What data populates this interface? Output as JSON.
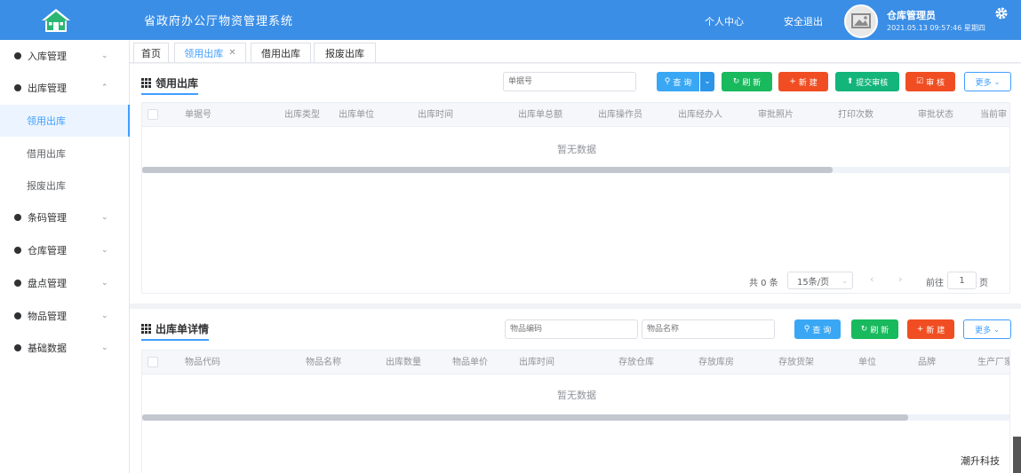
{
  "app": {
    "title": "省政府办公厅物资管理系统",
    "personal_center": "个人中心",
    "logout": "安全退出",
    "user_role": "仓库管理员",
    "user_time": "2021.05.13 09:57:46 星期四"
  },
  "sidebar": {
    "items": [
      {
        "label": "入库管理",
        "arrow": "⌄"
      },
      {
        "label": "出库管理",
        "arrow": "⌃"
      },
      {
        "label": "条码管理",
        "arrow": "⌄"
      },
      {
        "label": "仓库管理",
        "arrow": "⌄"
      },
      {
        "label": "盘点管理",
        "arrow": "⌄"
      },
      {
        "label": "物品管理",
        "arrow": "⌄"
      },
      {
        "label": "基础数据",
        "arrow": "⌄"
      }
    ],
    "submenu": [
      {
        "label": "领用出库"
      },
      {
        "label": "借用出库"
      },
      {
        "label": "报废出库"
      }
    ]
  },
  "tabs": [
    {
      "label": "首页"
    },
    {
      "label": "领用出库",
      "close": "✕"
    },
    {
      "label": "借用出库"
    },
    {
      "label": "报废出库"
    }
  ],
  "panel1": {
    "title": "领用出库",
    "search_placeholder": "单据号",
    "buttons": {
      "query": "查 询",
      "refresh": "刷 新",
      "new": "新 建",
      "submit": "提交审核",
      "review": "审 核",
      "more": "更多"
    },
    "columns": [
      "单据号",
      "出库类型",
      "出库单位",
      "出库时间",
      "出库单总额",
      "出库操作员",
      "出库经办人",
      "审批照片",
      "打印次数",
      "审批状态",
      "当前审"
    ],
    "empty_text": "暂无数据",
    "pager": {
      "total": "共 0 条",
      "page_size": "15条/页",
      "goto": "前往",
      "page": "1",
      "page_unit": "页"
    }
  },
  "panel2": {
    "title": "出库单详情",
    "code_placeholder": "物品编码",
    "name_placeholder": "物品名称",
    "buttons": {
      "query": "查 询",
      "refresh": "刷 新",
      "new": "新 建",
      "more": "更多"
    },
    "columns": [
      "物品代码",
      "物品名称",
      "出库数量",
      "物品单价",
      "出库时间",
      "存放仓库",
      "存放库房",
      "存放货架",
      "单位",
      "品牌",
      "生产厂家"
    ],
    "empty_text": "暂无数据"
  },
  "watermark": "潮升科技",
  "colors": {
    "header": "#3a8ee6",
    "primary": "#409eff",
    "green": "#19b95d",
    "red": "#f04e22"
  }
}
